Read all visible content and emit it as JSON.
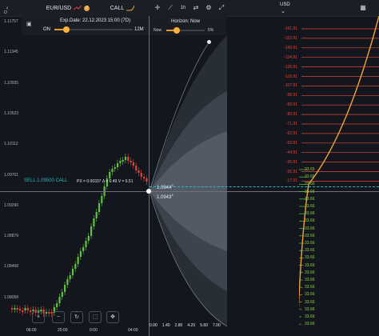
{
  "header": {
    "pair": "EUR/USD",
    "pair_badge": "7",
    "option_type": "CALL",
    "currency": "USD"
  },
  "controls": {
    "exp_date": "Exp.Date: 22.12.2023 15:00 (7D)",
    "toggle": "ON",
    "range_max": "12M",
    "horizon_title": "Horizon: Now",
    "horizon_left": "Now",
    "horizon_right": "5%"
  },
  "chart": {
    "top_label": "O",
    "y_labels": [
      "1.11757",
      "1.11345",
      "1.10935",
      "1.10523",
      "1.10112",
      "1.09701",
      "1.09290",
      "1.08879",
      "1.08468",
      "1.08058"
    ],
    "sell_label": "SELL 1.09500 CALL",
    "px_label": "PX = 0.00337 Δ = 0.49 V = 6.51",
    "price_marker_1": "1.0944",
    "price_marker_1_sup": "3",
    "price_marker_2": "1.0943",
    "price_marker_2_sup": "4",
    "x_labels": [
      "06:00",
      "20:00",
      "0:00",
      "04:00"
    ],
    "lower_axis": [
      "0.00",
      "1.40",
      "2.80",
      "4.20",
      "5.60",
      "7.00"
    ]
  },
  "pnl_scale": {
    "loss": [
      "-161.91",
      "-152.91",
      "-143.91",
      "-134.91",
      "-125.91",
      "-116.91",
      "-107.91",
      "-98.91",
      "-89.91",
      "-80.91",
      "-71.91",
      "-62.91",
      "-53.91",
      "-44.91",
      "-35.91",
      "-26.91",
      "-17.91"
    ],
    "profit": [
      "33.65",
      "33.66",
      "33.66",
      "33.66",
      "33.66",
      "33.66",
      "33.66",
      "33.66",
      "33.66",
      "33.66",
      "33.66",
      "33.66",
      "33.66",
      "33.66",
      "33.66",
      "33.66",
      "33.66",
      "33.66",
      "33.66",
      "33.66",
      "33.66",
      "33.66"
    ]
  },
  "colors": {
    "accent": "#f0a23a",
    "up": "#5fc23e",
    "down": "#e0443e",
    "cyan": "#2fb7c2"
  }
}
